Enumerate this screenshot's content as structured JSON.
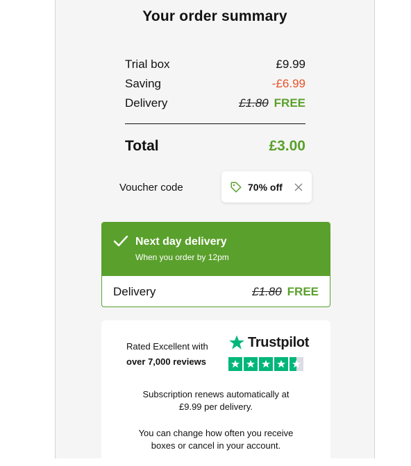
{
  "title": "Your order summary",
  "lines": {
    "trial_box_label": "Trial box",
    "trial_box_value": "£9.99",
    "saving_label": "Saving",
    "saving_value": "-£6.99",
    "delivery_label": "Delivery",
    "delivery_old": "£1.80",
    "delivery_value": "FREE"
  },
  "total": {
    "label": "Total",
    "value": "£3.00"
  },
  "voucher": {
    "label": "Voucher code",
    "code": "70% off"
  },
  "next_day": {
    "title": "Next day delivery",
    "subtitle": "When you order by 12pm",
    "delivery_label": "Delivery",
    "delivery_old": "£1.80",
    "delivery_value": "FREE"
  },
  "trust": {
    "rated_line1": "Rated Excellent with",
    "rated_line2": "over 7,000 reviews",
    "brand": "Trustpilot",
    "stars": 4.5
  },
  "notes": {
    "renew_line1": "Subscription renews automatically at",
    "renew_line2": "£9.99 per delivery.",
    "change_line1": "You can change how often you receive",
    "change_line2": "boxes or cancel in your account."
  },
  "colors": {
    "accent_green": "#5aa02c",
    "saving_red": "#e8522a",
    "trustpilot_green": "#00b67a"
  }
}
